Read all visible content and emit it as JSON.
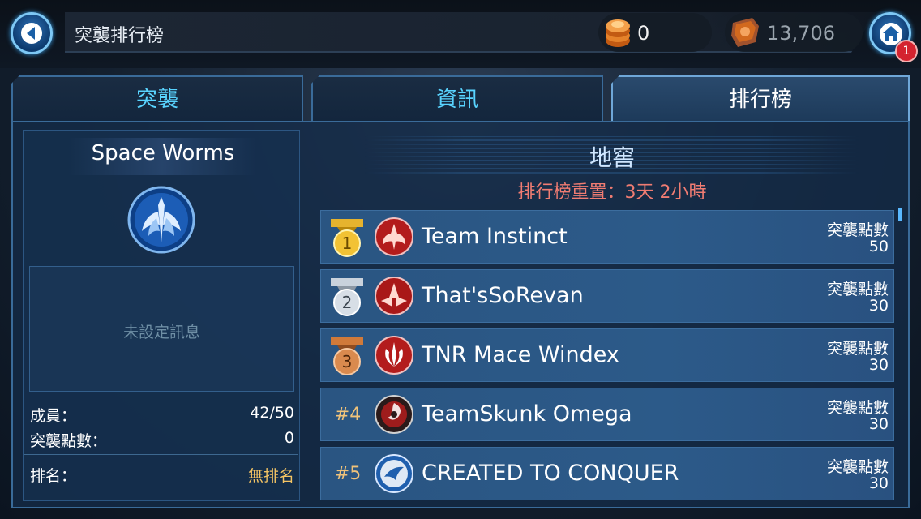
{
  "header": {
    "title": "突襲排行榜",
    "currency_crystals": "0",
    "currency_raid_tokens": "13,706",
    "notification_count": "1"
  },
  "tabs": [
    {
      "label": "突襲",
      "active": false
    },
    {
      "label": "資訊",
      "active": false
    },
    {
      "label": "排行榜",
      "active": true
    }
  ],
  "guild": {
    "name": "Space Worms",
    "message": "未設定訊息",
    "members_label": "成員：",
    "members_value": "42/50",
    "raid_points_label": "突襲點數：",
    "raid_points_value": "0",
    "rank_label": "排名：",
    "rank_value": "無排名"
  },
  "leaderboard": {
    "tier": "地窖",
    "reset_text": "排行榜重置：3天 2小時",
    "points_label": "突襲點數",
    "rows": [
      {
        "rank": "1",
        "name": "Team Instinct",
        "points": "50",
        "medal": "gold"
      },
      {
        "rank": "2",
        "name": "That'sSoRevan",
        "points": "30",
        "medal": "silver"
      },
      {
        "rank": "3",
        "name": "TNR Mace Windex",
        "points": "30",
        "medal": "bronze"
      },
      {
        "rank": "#4",
        "name": "TeamSkunk Omega",
        "points": "30",
        "medal": ""
      },
      {
        "rank": "#5",
        "name": "CREATED TO CONQUER",
        "points": "30",
        "medal": ""
      }
    ]
  },
  "colors": {
    "accent_cyan": "#59d4ff",
    "reset_red": "#f07c72",
    "rank_gold": "#f5c564"
  },
  "icons": {
    "back": "back-arrow-icon",
    "home": "home-icon",
    "crystal": "crystal-icon",
    "raid_token": "raid-token-icon",
    "guild_emblem": "old-republic-emblem-icon"
  }
}
